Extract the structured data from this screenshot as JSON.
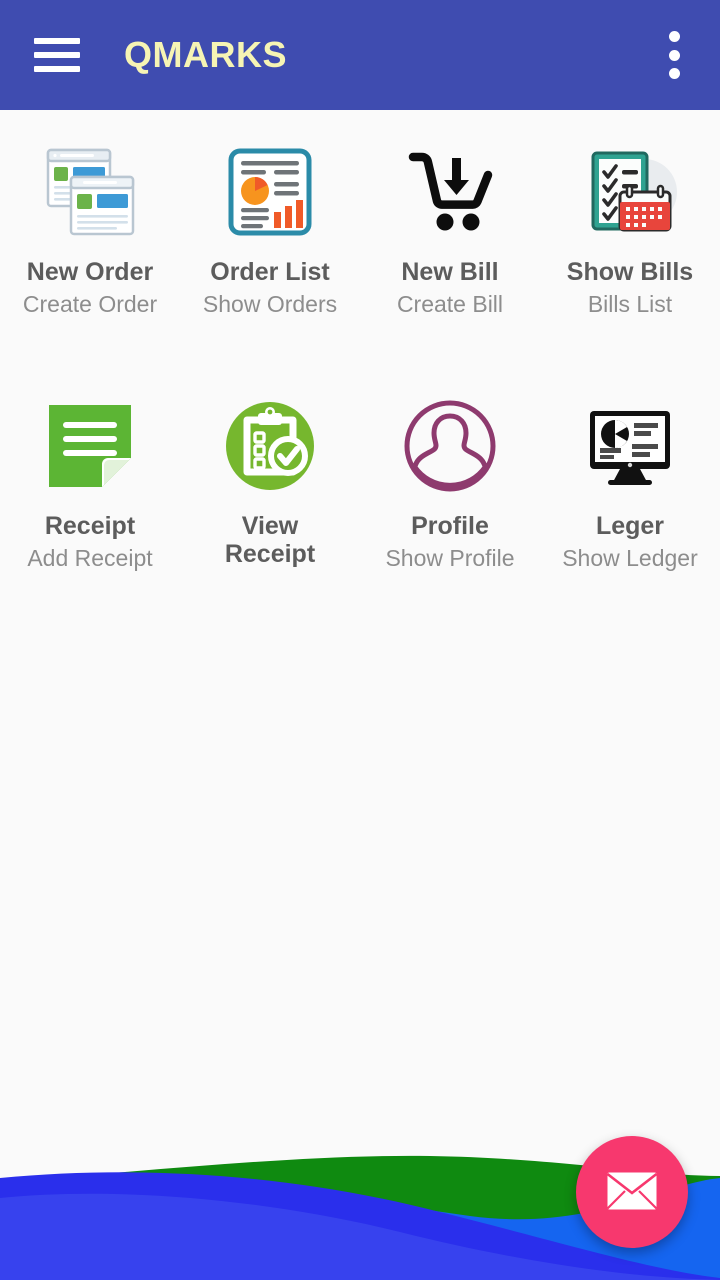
{
  "header": {
    "title": "QMARKS",
    "menu_icon": "hamburger-menu-icon",
    "overflow_icon": "more-vertical-icon",
    "background_color": "#3f4cb0",
    "title_color": "#f6f4b4"
  },
  "grid": {
    "tiles": [
      {
        "title": "New Order",
        "subtitle": "Create Order",
        "icon": "stacked-windows-icon"
      },
      {
        "title": "Order List",
        "subtitle": "Show Orders",
        "icon": "report-chart-icon"
      },
      {
        "title": "New Bill",
        "subtitle": "Create Bill",
        "icon": "cart-download-icon"
      },
      {
        "title": "Show Bills",
        "subtitle": "Bills List",
        "icon": "checklist-calendar-icon"
      },
      {
        "title": "Receipt",
        "subtitle": "Add Receipt",
        "icon": "green-note-icon"
      },
      {
        "title": "View Receipt",
        "subtitle": "",
        "icon": "clipboard-check-icon"
      },
      {
        "title": "Profile",
        "subtitle": "Show Profile",
        "icon": "person-circle-icon"
      },
      {
        "title": "Leger",
        "subtitle": "Show Ledger",
        "icon": "monitor-chart-icon"
      }
    ]
  },
  "fab": {
    "icon": "envelope-icon",
    "color": "#f7386e"
  },
  "decoration": {
    "wave_green": "#128c12",
    "wave_blue_dark": "#1a21e8",
    "wave_blue_light": "#1565f0",
    "wave_blue_mid": "#3a45ee"
  }
}
